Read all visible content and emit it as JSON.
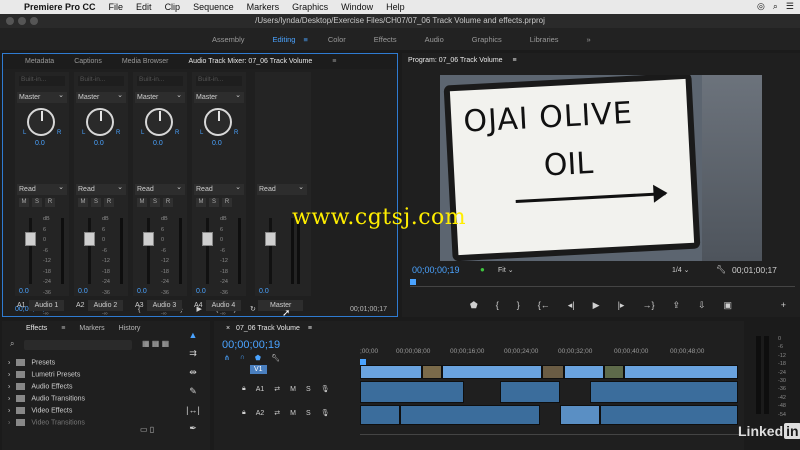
{
  "menubar": {
    "app_name": "Premiere Pro CC",
    "items": [
      "File",
      "Edit",
      "Clip",
      "Sequence",
      "Markers",
      "Graphics",
      "Window",
      "Help"
    ]
  },
  "window": {
    "title": "/Users/lynda/Desktop/Exercise Files/CH07/07_06 Track Volume and effects.prproj"
  },
  "workspaces": {
    "items": [
      "Assembly",
      "Editing",
      "Color",
      "Effects",
      "Audio",
      "Graphics",
      "Libraries"
    ],
    "active": "Editing"
  },
  "mixer": {
    "tabs": [
      "Metadata",
      "Captions",
      "Media Browser",
      "Audio Track Mixer: 07_06 Track Volume"
    ],
    "active_tab": "Audio Track Mixer: 07_06 Track Volume",
    "builtin_label": "Built-in...",
    "strips": [
      {
        "id": "A1",
        "name": "Audio 1",
        "output": "Master",
        "mode": "Read",
        "pan": "0.0",
        "vol": "0.0",
        "fader": 0.26
      },
      {
        "id": "A2",
        "name": "Audio 2",
        "output": "Master",
        "mode": "Read",
        "pan": "0.0",
        "vol": "0.0",
        "fader": 0.26
      },
      {
        "id": "A3",
        "name": "Audio 3",
        "output": "Master",
        "mode": "Read",
        "pan": "0.0",
        "vol": "0.0",
        "fader": 0.26
      },
      {
        "id": "A4",
        "name": "Audio 4",
        "output": "Master",
        "mode": "Read",
        "pan": "0.0",
        "vol": "0.0",
        "fader": 0.26
      }
    ],
    "master": {
      "name": "Master",
      "mode": "Read",
      "vol": "0.0"
    },
    "db_scale": [
      "dB",
      "6",
      "0",
      "-6",
      "-12",
      "-18",
      "-24",
      "-36",
      "-48",
      "-∞"
    ],
    "timecode_left": "00;00;00;19",
    "timecode_right": "00;01;00;17"
  },
  "program": {
    "title": "Program: 07_06 Track Volume",
    "sign_line1": "OJAI OLIVE",
    "sign_line2": "OIL",
    "watermark": "www.cgtsj.com",
    "timecode": "00;00;00;19",
    "fit": "Fit",
    "resolution": "1/4",
    "duration": "00;01;00;17"
  },
  "effects": {
    "tabs": [
      "Effects",
      "Markers",
      "History"
    ],
    "active_tab": "Effects",
    "items": [
      "Presets",
      "Lumetri Presets",
      "Audio Effects",
      "Audio Transitions",
      "Video Effects",
      "Video Transitions"
    ]
  },
  "timeline": {
    "title": "07_06 Track Volume",
    "timecode": "00;00;00;19",
    "ruler": [
      ";00;00",
      "00;00;08;00",
      "00;00;16;00",
      "00;00;24;00",
      "00;00;32;00",
      "00;00;40;00",
      "00;00;48;00"
    ],
    "tracks": [
      {
        "name": "V1",
        "type": "video"
      },
      {
        "name": "A1",
        "type": "audio"
      },
      {
        "name": "A2",
        "type": "audio"
      }
    ]
  },
  "right_meter": {
    "scale": [
      "0",
      "-6",
      "-12",
      "-18",
      "-24",
      "-30",
      "-36",
      "-42",
      "-48",
      "-54"
    ]
  },
  "branding": {
    "text": "Linked",
    "badge": "in"
  }
}
